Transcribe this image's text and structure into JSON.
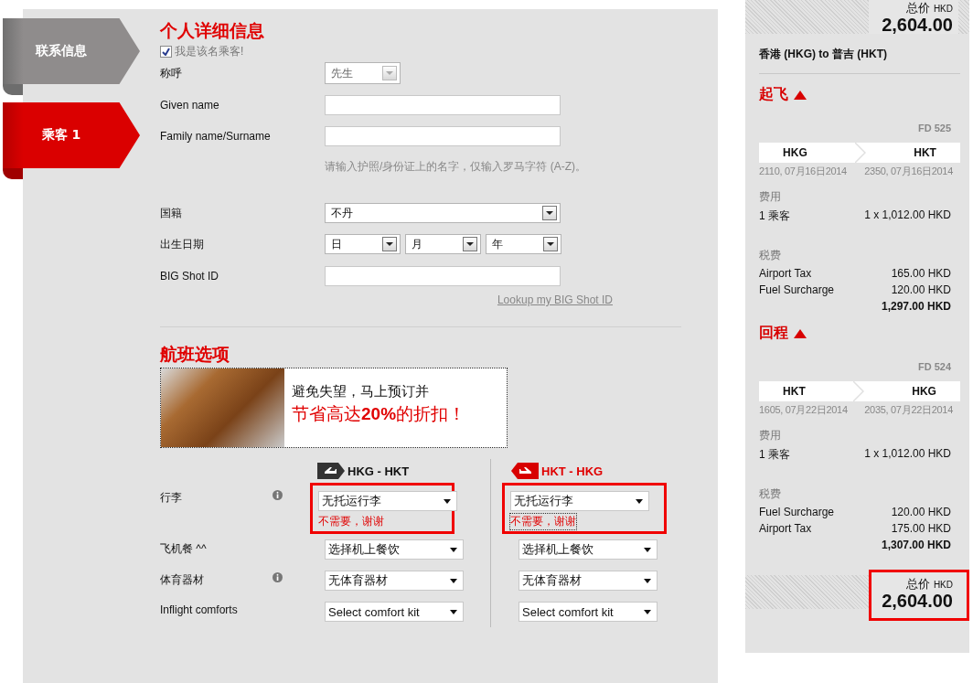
{
  "steps": [
    {
      "label": "联系信息",
      "selected": false
    },
    {
      "label": "乘客 1",
      "selected": true
    }
  ],
  "personal": {
    "title": "个人详细信息",
    "passenger_checkbox": {
      "label": "我是该名乘客!",
      "checked": true
    },
    "rows": [
      {
        "kind": "picker",
        "label": "称呼",
        "value": "先生",
        "disabled": true
      },
      {
        "kind": "text",
        "label": "Given name"
      },
      {
        "kind": "text",
        "label": "Family name/Surname"
      },
      {
        "kind": "note",
        "text": "请输入护照/身份证上的名字，仅输入罗马字符 (A-Z)。"
      },
      {
        "kind": "select",
        "label": "国籍",
        "value": "不丹"
      },
      {
        "kind": "date",
        "label": "出生日期",
        "parts": [
          "日",
          "月",
          "年"
        ]
      },
      {
        "kind": "text",
        "label": "BIG Shot ID"
      },
      {
        "kind": "link",
        "text": "Lookup my BIG Shot ID"
      }
    ]
  },
  "flight_options": {
    "title": "航班选项",
    "banner": {
      "line1": "避免失望，马上预订并",
      "line2": "节省高达**20%**的折扣！"
    },
    "legs": [
      {
        "kind": "outbound",
        "label": "HKG - HKT"
      },
      {
        "kind": "return",
        "label": "HKT - HKG"
      }
    ],
    "options": [
      {
        "label": "行李",
        "info": true,
        "highlighted": true,
        "values": [
          {
            "value": "无托运行李",
            "note": "不需要，谢谢"
          },
          {
            "value": "无托运行李",
            "note": "不需要，谢谢"
          }
        ]
      },
      {
        "label": "飞机餐 ^^",
        "info": false,
        "highlighted": false,
        "values": [
          {
            "value": "选择机上餐饮"
          },
          {
            "value": "选择机上餐饮"
          }
        ]
      },
      {
        "label": "体育器材",
        "info": true,
        "highlighted": false,
        "values": [
          {
            "value": "无体育器材"
          },
          {
            "value": "无体育器材"
          }
        ]
      },
      {
        "label": "Inflight comforts",
        "info": false,
        "highlighted": false,
        "values": [
          {
            "value": "Select comfort kit"
          },
          {
            "value": "Select comfort kit"
          }
        ]
      }
    ]
  },
  "summary": {
    "total_top": {
      "label": "总价",
      "currency": "HKD",
      "amount": "2,604.00",
      "highlighted": false
    },
    "route": "香港 (HKG) to 普吉 (HKT)",
    "segments": [
      {
        "heading": "起飞",
        "expanded": true,
        "flight": "FD 525",
        "from": "HKG",
        "to": "HKT",
        "depart": "2110, 07月16日2014",
        "arrive": "2350, 07月16日2014",
        "fare_heading": "费用",
        "fare_label": "1 乘客",
        "fare_amount": "1 x 1,012.00 HKD",
        "tax_heading": "税费",
        "taxes": [
          {
            "label": "Airport Tax",
            "amount": "165.00 HKD"
          },
          {
            "label": "Fuel Surcharge",
            "amount": "120.00 HKD"
          }
        ],
        "subtotal": "1,297.00 HKD"
      },
      {
        "heading": "回程",
        "expanded": true,
        "flight": "FD 524",
        "from": "HKT",
        "to": "HKG",
        "depart": "1605, 07月22日2014",
        "arrive": "2035, 07月22日2014",
        "fare_heading": "费用",
        "fare_label": "1 乘客",
        "fare_amount": "1 x 1,012.00 HKD",
        "tax_heading": "税费",
        "taxes": [
          {
            "label": "Fuel Surcharge",
            "amount": "120.00 HKD"
          },
          {
            "label": "Airport Tax",
            "amount": "175.00 HKD"
          }
        ],
        "subtotal": "1,307.00 HKD"
      }
    ],
    "total_bottom": {
      "label": "总价",
      "currency": "HKD",
      "amount": "2,604.00",
      "highlighted": true
    }
  }
}
